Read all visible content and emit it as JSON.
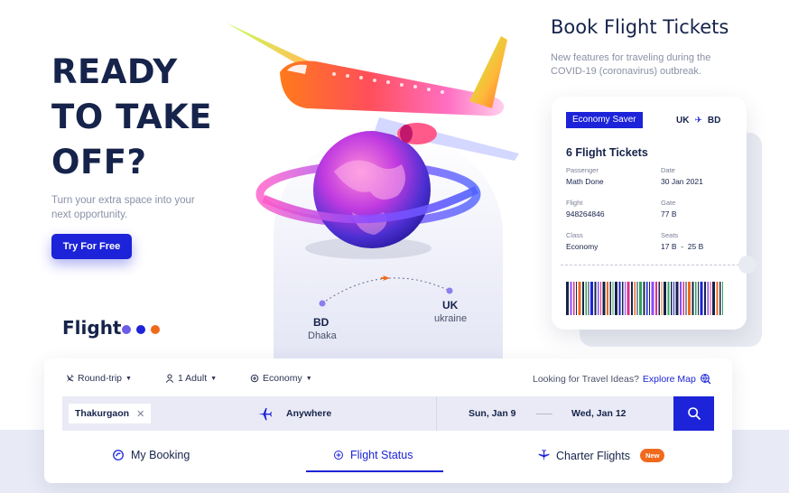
{
  "hero": {
    "title_line1": "READY",
    "title_line2": "TO TAKE",
    "title_line3": "OFF?",
    "subtitle": "Turn your extra space into your next opportunity.",
    "cta_label": "Try For Free"
  },
  "flight_section": {
    "label": "Flight",
    "dot_colors": [
      "#6c5ce7",
      "#1c23d8",
      "#f06a1e"
    ]
  },
  "route": {
    "from_code": "BD",
    "from_city": "Dhaka",
    "to_code": "UK",
    "to_city": "ukraine"
  },
  "book": {
    "title": "Book Flight Tickets",
    "subtitle": "New features for traveling during the COVID-19 (coronavirus) outbreak."
  },
  "ticket": {
    "fare_class": "Economy Saver",
    "origin": "UK",
    "destination": "BD",
    "count": "6 Flight Tickets",
    "fields": {
      "passenger_label": "Passenger",
      "passenger_value": "Math Done",
      "date_label": "Date",
      "date_value": "30 Jan 2021",
      "flight_label": "Flight",
      "flight_value": "948264846",
      "gate_label": "Gate",
      "gate_value": "77 B",
      "class_label": "Class",
      "class_value": "Economy",
      "seats_label": "Seats",
      "seats_value": "17 B  -  25 B"
    }
  },
  "search": {
    "trip_type": "Round-trip",
    "passengers": "1 Adult",
    "cabin": "Economy",
    "ideas_text": "Looking for Travel Ideas?",
    "explore_link": "Explore Map",
    "origin_chip": "Thakurgaon",
    "destination": "Anywhere",
    "depart_date": "Sun, Jan 9",
    "return_date": "Wed, Jan 12"
  },
  "tabs": {
    "my_booking": "My Booking",
    "flight_status": "Flight Status",
    "charter_flights": "Charter Flights",
    "new_badge": "New"
  },
  "colors": {
    "primary": "#1c23d8",
    "navy": "#16234a",
    "accent_orange": "#f06a1e",
    "panel_bg": "#e9eaf5"
  },
  "icons": [
    "plane-icon",
    "person-icon",
    "seat-icon",
    "globe-icon",
    "search-icon",
    "booking-icon",
    "plus-circle-icon",
    "close-icon"
  ]
}
